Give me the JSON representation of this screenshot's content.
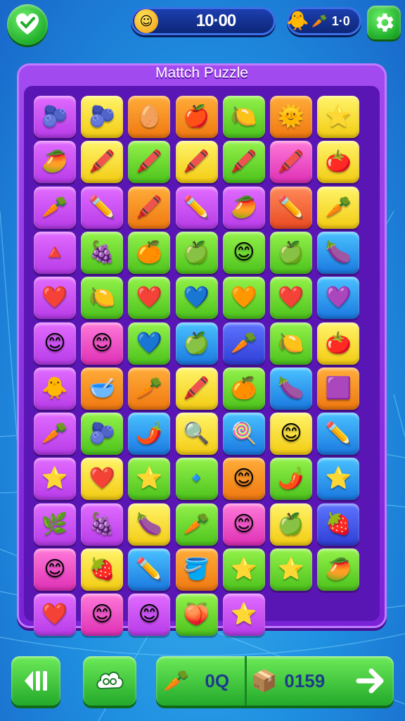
{
  "topbar": {
    "back_icon": "heart-check-icon",
    "timer_icon": "smiley-coin-icon",
    "timer": "10·00",
    "score_icon": "rocket-icon",
    "score_item_icon": "carrot-icon",
    "score": "1·0",
    "settings_icon": "gear-icon"
  },
  "board": {
    "title": "Mattch Puzzle",
    "tiles": [
      {
        "c": "purple",
        "g": "🫐"
      },
      {
        "c": "yellow",
        "g": "🫐"
      },
      {
        "c": "orange",
        "g": "🥚"
      },
      {
        "c": "orange",
        "g": "🍎"
      },
      {
        "c": "green",
        "g": "🍋"
      },
      {
        "c": "orange",
        "g": "🌞"
      },
      {
        "c": "yellow",
        "g": "⭐"
      },
      {
        "c": "purple",
        "g": "🥭"
      },
      {
        "c": "yellow",
        "g": "🖍️"
      },
      {
        "c": "green",
        "g": "🖍️"
      },
      {
        "c": "yellow",
        "g": "🖍️"
      },
      {
        "c": "green",
        "g": "🖍️"
      },
      {
        "c": "pink",
        "g": "🖍️"
      },
      {
        "c": "yellow",
        "g": "🍅"
      },
      {
        "c": "purple",
        "g": "🥕"
      },
      {
        "c": "purple",
        "g": "✏️"
      },
      {
        "c": "orange",
        "g": "🖍️"
      },
      {
        "c": "purple",
        "g": "✏️"
      },
      {
        "c": "purple",
        "g": "🥭"
      },
      {
        "c": "red",
        "g": "✏️"
      },
      {
        "c": "yellow",
        "g": "🥕"
      },
      {
        "c": "purple",
        "g": "🔺"
      },
      {
        "c": "green",
        "g": "🍇"
      },
      {
        "c": "green",
        "g": "🍊"
      },
      {
        "c": "green",
        "g": "🍏"
      },
      {
        "c": "green",
        "g": "😊"
      },
      {
        "c": "green",
        "g": "🍏"
      },
      {
        "c": "blue",
        "g": "🍆"
      },
      {
        "c": "purple",
        "g": "❤️"
      },
      {
        "c": "green",
        "g": "🍋"
      },
      {
        "c": "green",
        "g": "❤️"
      },
      {
        "c": "green",
        "g": "💙"
      },
      {
        "c": "green",
        "g": "🧡"
      },
      {
        "c": "green",
        "g": "❤️"
      },
      {
        "c": "blue",
        "g": "💜"
      },
      {
        "c": "purple",
        "g": "😊"
      },
      {
        "c": "pink",
        "g": "😊"
      },
      {
        "c": "green",
        "g": "💙"
      },
      {
        "c": "blue",
        "g": "🍏"
      },
      {
        "c": "dblue",
        "g": "🥕"
      },
      {
        "c": "green",
        "g": "🍋"
      },
      {
        "c": "yellow",
        "g": "🍅"
      },
      {
        "c": "purple",
        "g": "🐥"
      },
      {
        "c": "orange",
        "g": "🥣"
      },
      {
        "c": "orange",
        "g": "🥕"
      },
      {
        "c": "yellow",
        "g": "🖍️"
      },
      {
        "c": "green",
        "g": "🍊"
      },
      {
        "c": "blue",
        "g": "🍆"
      },
      {
        "c": "orange",
        "g": "🟪"
      },
      {
        "c": "purple",
        "g": "🥕"
      },
      {
        "c": "green",
        "g": "🫐"
      },
      {
        "c": "blue",
        "g": "🌶️"
      },
      {
        "c": "yellow",
        "g": "🔍"
      },
      {
        "c": "blue",
        "g": "🍭"
      },
      {
        "c": "yellow",
        "g": "😊"
      },
      {
        "c": "blue",
        "g": "✏️"
      },
      {
        "c": "purple",
        "g": "⭐"
      },
      {
        "c": "yellow",
        "g": "❤️"
      },
      {
        "c": "green",
        "g": "⭐"
      },
      {
        "c": "green",
        "g": "🔹"
      },
      {
        "c": "orange",
        "g": "😊"
      },
      {
        "c": "green",
        "g": "🌶️"
      },
      {
        "c": "blue",
        "g": "⭐"
      },
      {
        "c": "purple",
        "g": "🌿"
      },
      {
        "c": "purple",
        "g": "🍇"
      },
      {
        "c": "yellow",
        "g": "🍆"
      },
      {
        "c": "green",
        "g": "🥕"
      },
      {
        "c": "pink",
        "g": "😊"
      },
      {
        "c": "yellow",
        "g": "🍏"
      },
      {
        "c": "dblue",
        "g": "🍓"
      },
      {
        "c": "pink",
        "g": "😊"
      },
      {
        "c": "yellow",
        "g": "🍓"
      },
      {
        "c": "blue",
        "g": "✏️"
      },
      {
        "c": "orange",
        "g": "🪣"
      },
      {
        "c": "green",
        "g": "⭐"
      },
      {
        "c": "green",
        "g": "⭐"
      },
      {
        "c": "green",
        "g": "🥭"
      },
      {
        "c": "purple",
        "g": "❤️"
      },
      {
        "c": "pink",
        "g": "😊"
      },
      {
        "c": "purple",
        "g": "😊"
      },
      {
        "c": "green",
        "g": "🍑"
      },
      {
        "c": "purple",
        "g": "⭐"
      }
    ]
  },
  "bottombar": {
    "pause_icon": "pause-icon",
    "hint_icon": "cloud-icon",
    "moves_icon": "carrot-icon",
    "moves": "0Q",
    "coins_icon": "crate-icon",
    "coins": "0159",
    "next_icon": "arrow-right-icon"
  },
  "colors": {
    "purple": "#c94ef5",
    "yellow": "#f7dc2a",
    "orange": "#f58d20",
    "green": "#6ed430",
    "blue": "#2d9ff0",
    "pink": "#ea4fc6",
    "red": "#f05c30",
    "dblue": "#3d52e8"
  }
}
